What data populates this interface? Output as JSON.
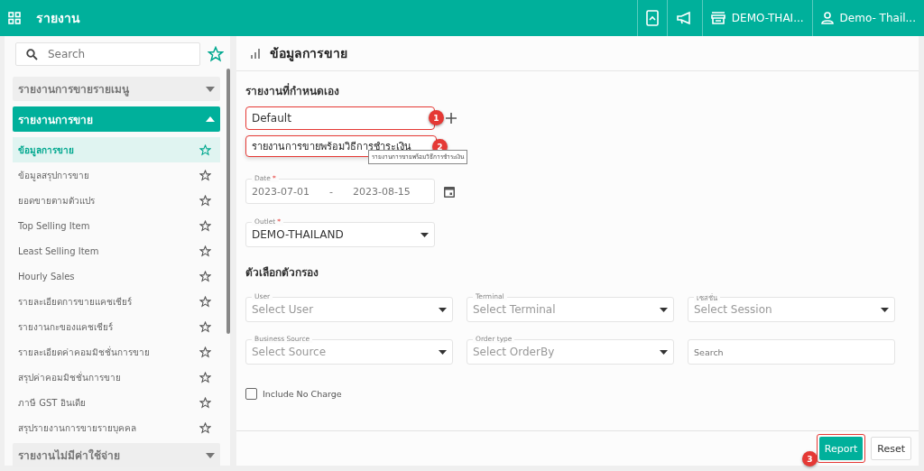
{
  "topbar": {
    "title": "รายงาน",
    "outlet": "DEMO-THAI...",
    "user": "Demo- Thail..."
  },
  "sidebar": {
    "search": {
      "placeholder": "Search"
    },
    "groups": [
      {
        "title": "รายงานการขายรายเมนู",
        "expanded": false
      },
      {
        "title": "รายงานการขาย",
        "expanded": true,
        "items": [
          {
            "label": "ข้อมูลการขาย",
            "selected": true
          },
          {
            "label": "ข้อมูลสรุปการขาย",
            "selected": false
          },
          {
            "label": "ยอดขายตามตัวแปร",
            "selected": false
          },
          {
            "label": "Top Selling Item",
            "selected": false
          },
          {
            "label": "Least Selling Item",
            "selected": false
          },
          {
            "label": "Hourly Sales",
            "selected": false
          },
          {
            "label": "รายละเอียดการขายแคชเชียร์",
            "selected": false
          },
          {
            "label": "รายงานกะของแคชเชียร์",
            "selected": false
          },
          {
            "label": "รายละเอียดค่าคอมมิชชั่นการขาย",
            "selected": false
          },
          {
            "label": "สรุปค่าคอมมิชชั่นการขาย",
            "selected": false
          },
          {
            "label": "ภาษี GST อินเดีย",
            "selected": false
          },
          {
            "label": "สรุปรายงานการขายรายบุคคล",
            "selected": false
          }
        ]
      },
      {
        "title": "รายงานไม่มีค่าใช้จ่าย",
        "expanded": false
      }
    ]
  },
  "main": {
    "title": "ข้อมูลการขาย",
    "custom_report": {
      "heading": "รายงานที่กำหนดเอง",
      "value": "Default",
      "callout": "1",
      "dropdown_option": {
        "label": "รายงานการขายพร้อมวิธีการชำระเงิน",
        "callout": "2"
      },
      "tooltip": "รายงานการขายพร้อมวิธีการชำระเงิน"
    },
    "date": {
      "label": "Date",
      "required_mark": "*",
      "from": "2023-07-01",
      "separator": "-",
      "to": "2023-08-15"
    },
    "outlet": {
      "label": "Outlet",
      "required_mark": "*",
      "value": "DEMO-THAILAND"
    },
    "filters": {
      "heading": "ตัวเลือกตัวกรอง",
      "fields": [
        {
          "kind": "select",
          "label": "User",
          "placeholder": "Select User"
        },
        {
          "kind": "select",
          "label": "Terminal",
          "placeholder": "Select Terminal"
        },
        {
          "kind": "select",
          "label": "เซสชั่น",
          "placeholder": "Select Session"
        },
        {
          "kind": "select",
          "label": "Business Source",
          "placeholder": "Select Source"
        },
        {
          "kind": "select",
          "label": "Order type",
          "placeholder": "Select OrderBy"
        },
        {
          "kind": "search",
          "placeholder": "Search"
        }
      ]
    },
    "include_no_charge": {
      "label": "Include No Charge",
      "checked": false
    },
    "buttons": [
      {
        "kind": "primary",
        "label": "Report",
        "callout": "3"
      },
      {
        "kind": "secondary",
        "label": "Reset"
      }
    ]
  }
}
